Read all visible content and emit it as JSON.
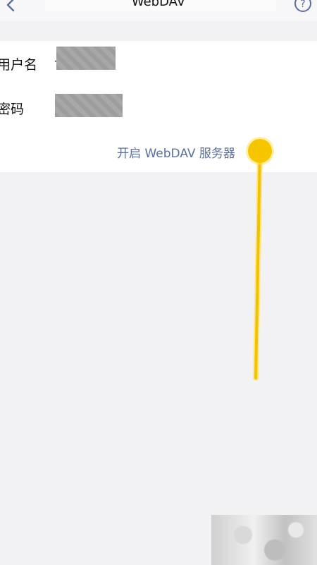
{
  "nav": {
    "title": "WebDAV",
    "back_icon": "chevron-left-icon",
    "help_icon": "question-circle-icon",
    "help_glyph": "?"
  },
  "form": {
    "username_label": "用户名",
    "username_value_hint": "·",
    "password_label": "密码",
    "action_label": "开启 WebDAV 服务器"
  },
  "colors": {
    "link": "#5a6f9d",
    "gesture": "#f7c400",
    "background": "#f2f2f5",
    "card": "#ffffff"
  }
}
